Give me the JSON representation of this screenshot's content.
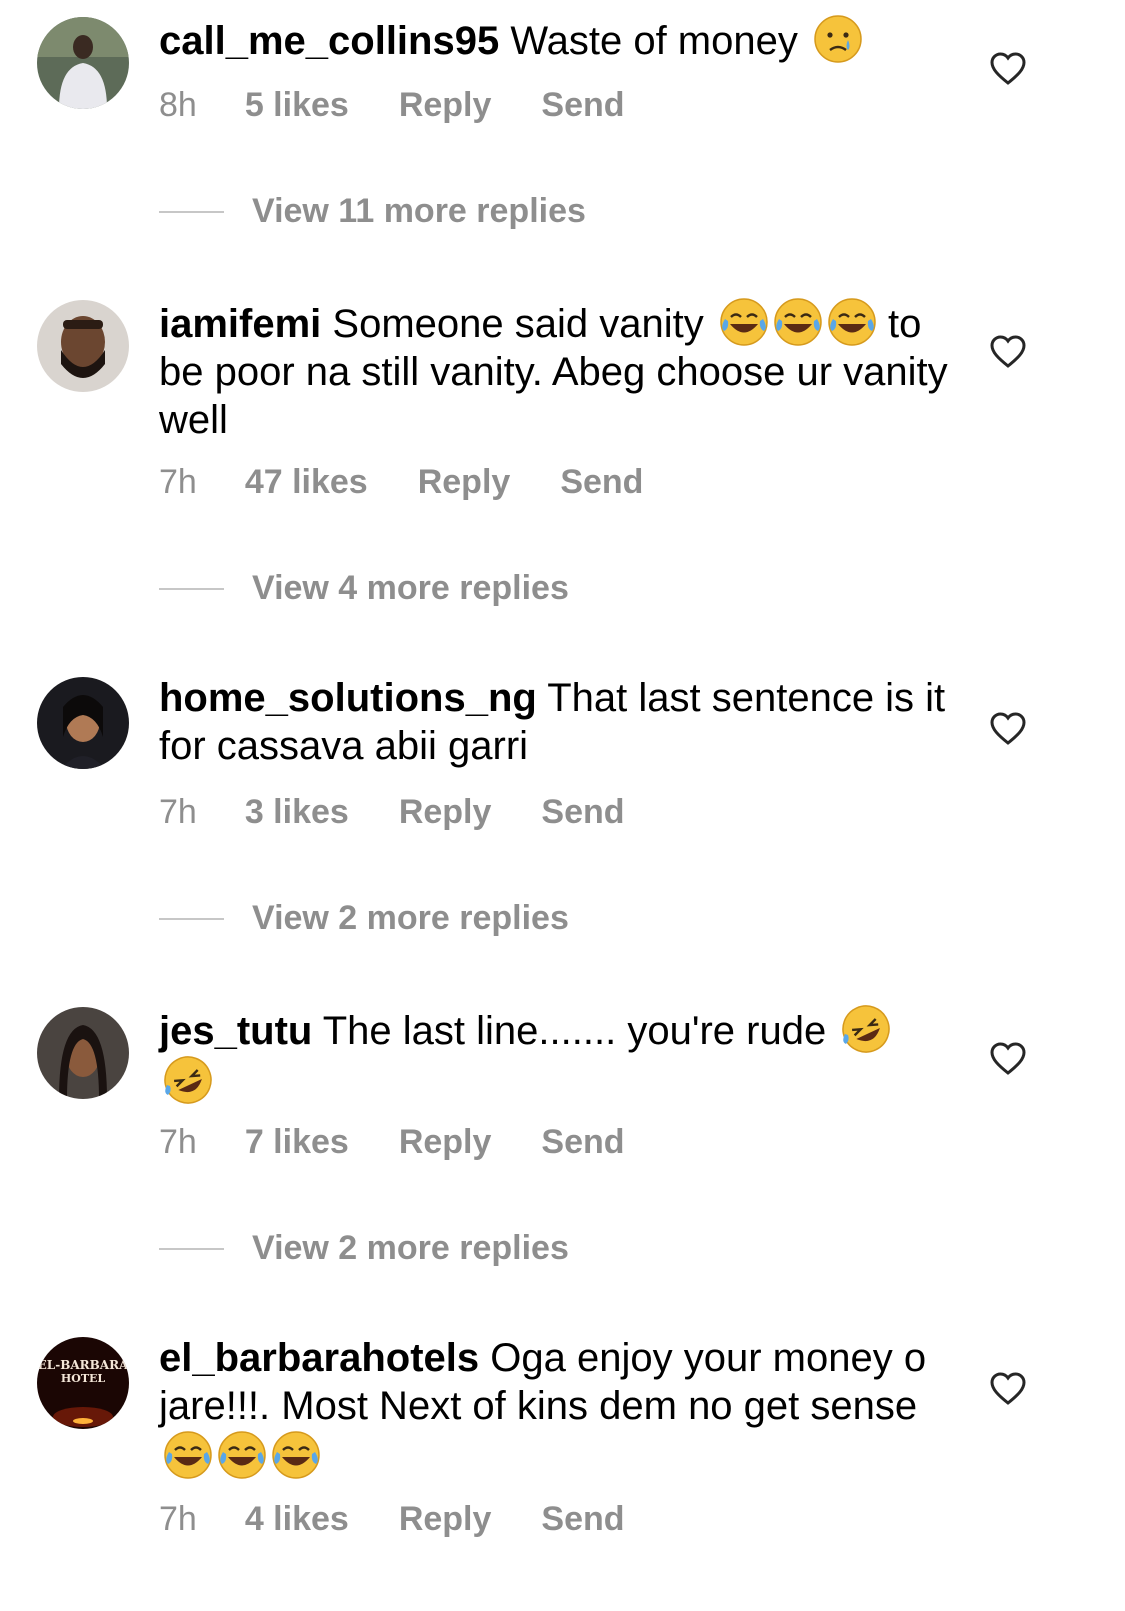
{
  "colors": {
    "meta_gray": "#8e8e8e",
    "divider": "#c7c7c7",
    "text": "#000000"
  },
  "comments": [
    {
      "username": "call_me_collins95",
      "text": "Waste of money",
      "emojis": [
        "crying-face"
      ],
      "time": "8h",
      "likes": "5 likes",
      "reply": "Reply",
      "send": "Send",
      "view_replies": "View 11 more replies"
    },
    {
      "username": "iamifemi",
      "text": "Someone said vanity",
      "text_after": "to be poor na still vanity. Abeg choose ur vanity well",
      "emojis": [
        "tears-of-joy",
        "tears-of-joy",
        "tears-of-joy"
      ],
      "time": "7h",
      "likes": "47 likes",
      "reply": "Reply",
      "send": "Send",
      "view_replies": "View 4 more replies"
    },
    {
      "username": "home_solutions_ng",
      "text": "That last sentence is it for cassava abii garri",
      "time": "7h",
      "likes": "3 likes",
      "reply": "Reply",
      "send": "Send",
      "view_replies": "View 2 more replies"
    },
    {
      "username": "jes_tutu",
      "text": "The last line....... you're rude",
      "emojis": [
        "rolling-laughing",
        "rolling-laughing"
      ],
      "time": "7h",
      "likes": "7 likes",
      "reply": "Reply",
      "send": "Send",
      "view_replies": "View 2 more replies"
    },
    {
      "username": "el_barbarahotels",
      "text": "Oga enjoy your money o jare!!!. Most Next of kins dem no get sense",
      "emojis": [
        "tears-of-joy",
        "tears-of-joy",
        "tears-of-joy"
      ],
      "avatar_text": "EL-BARBARA HOTEL",
      "time": "7h",
      "likes": "4 likes",
      "reply": "Reply",
      "send": "Send"
    }
  ]
}
